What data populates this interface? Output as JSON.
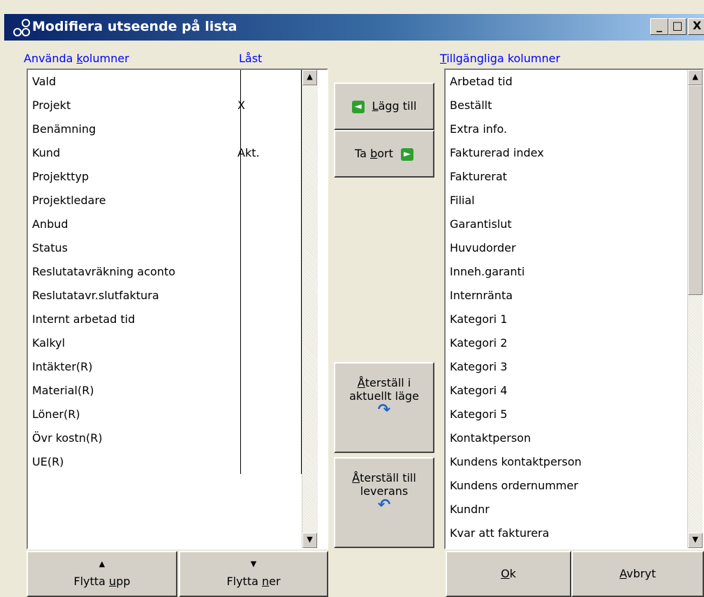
{
  "window": {
    "title": "Modifiera utseende på lista",
    "controls": {
      "minimize": "_",
      "maximize": "□",
      "close": "X"
    }
  },
  "used_columns": {
    "label_prefix": "Använda ",
    "label_accel": "k",
    "label_suffix": "olumner",
    "locked_header": "Låst",
    "items": [
      {
        "name": "Vald",
        "locked": ""
      },
      {
        "name": "Projekt",
        "locked": "X"
      },
      {
        "name": "Benämning",
        "locked": ""
      },
      {
        "name": "Kund",
        "locked": "Akt."
      },
      {
        "name": "Projekttyp",
        "locked": ""
      },
      {
        "name": "Projektledare",
        "locked": ""
      },
      {
        "name": "Anbud",
        "locked": ""
      },
      {
        "name": "Status",
        "locked": ""
      },
      {
        "name": "Reslutatavräkning aconto",
        "locked": ""
      },
      {
        "name": "Reslutatavr.slutfaktura",
        "locked": ""
      },
      {
        "name": "Internt arbetad tid",
        "locked": ""
      },
      {
        "name": "Kalkyl",
        "locked": ""
      },
      {
        "name": "Intäkter(R)",
        "locked": ""
      },
      {
        "name": "Material(R)",
        "locked": ""
      },
      {
        "name": "Löner(R)",
        "locked": ""
      },
      {
        "name": "Övr kostn(R)",
        "locked": ""
      },
      {
        "name": "UE(R)",
        "locked": ""
      }
    ]
  },
  "available_columns": {
    "label_accel": "T",
    "label_rest": "illgängliga kolumner",
    "items": [
      "Arbetad tid",
      "Beställt",
      "Extra info.",
      "Fakturerad index",
      "Fakturerat",
      "Filial",
      "Garantislut",
      "Huvudorder",
      "Inneh.garanti",
      "Internränta",
      "Kategori 1",
      "Kategori 2",
      "Kategori 3",
      "Kategori 4",
      "Kategori 5",
      "Kontaktperson",
      "Kundens kontaktperson",
      "Kundens ordernummer",
      "Kundnr",
      "Kvar att fakturera"
    ]
  },
  "buttons": {
    "add": {
      "accel": "L",
      "rest": "ägg till"
    },
    "remove": {
      "pre": "Ta ",
      "accel": "b",
      "rest": "ort"
    },
    "reset_current": {
      "accel": "Å",
      "line1_rest": "terställ i",
      "line2": "aktuellt läge"
    },
    "reset_delivery": {
      "accel": "Å",
      "line1_rest": "terställ till",
      "line2": "leverans"
    },
    "move_up": {
      "pre": "Flytta ",
      "accel": "u",
      "rest": "pp"
    },
    "move_down": {
      "pre": "Flytta ",
      "accel": "n",
      "rest": "er"
    },
    "ok": {
      "accel": "O",
      "rest": "k"
    },
    "cancel": {
      "accel": "A",
      "rest": "vbryt"
    }
  },
  "icons": {
    "add": "arrow-left-green-icon",
    "remove": "arrow-right-green-icon",
    "reset_current": "redo-arrow-icon",
    "reset_delivery": "undo-arrow-icon",
    "title": "app-icon"
  },
  "colors": {
    "section_label": "#0000ff",
    "title_start": "#0a246a",
    "title_end": "#a6caf0",
    "face": "#d4d0c8"
  }
}
